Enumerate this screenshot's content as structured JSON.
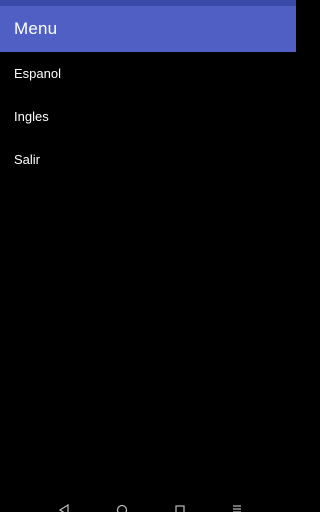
{
  "app_bar": {
    "title": "Menu",
    "color": "#4f5fc4",
    "status_bar_color": "#3a4aa8"
  },
  "menu": {
    "items": [
      {
        "label": "Espanol"
      },
      {
        "label": "Ingles"
      },
      {
        "label": "Salir"
      }
    ]
  },
  "navigation_bar": {
    "buttons": [
      {
        "icon": "back-triangle-icon"
      },
      {
        "icon": "home-circle-icon"
      },
      {
        "icon": "recents-square-icon"
      },
      {
        "icon": "menu-lines-icon"
      }
    ]
  }
}
